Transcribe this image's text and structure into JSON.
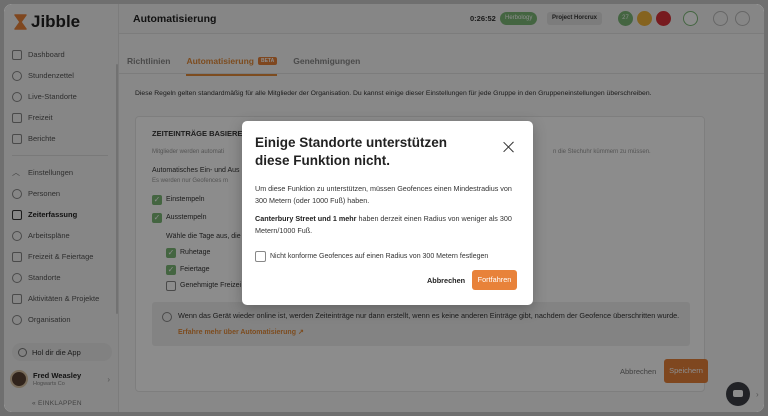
{
  "app": {
    "logo": "Jibble"
  },
  "sidebar": {
    "items": [
      {
        "label": "Dashboard"
      },
      {
        "label": "Stundenzettel"
      },
      {
        "label": "Live-Standorte"
      },
      {
        "label": "Freizeit"
      },
      {
        "label": "Berichte"
      },
      {
        "label": "Einstellungen"
      },
      {
        "label": "Personen"
      },
      {
        "label": "Zeiterfassung"
      },
      {
        "label": "Arbeitspläne"
      },
      {
        "label": "Freizeit & Feiertage"
      },
      {
        "label": "Standorte"
      },
      {
        "label": "Aktivitäten & Projekte"
      },
      {
        "label": "Organisation"
      }
    ],
    "app_button": "Hol dir die App",
    "user": {
      "name": "Fred Weasley",
      "org": "Hogwarts Co"
    },
    "collapse": "EINKLAPPEN"
  },
  "header": {
    "title": "Automatisierung",
    "timer": "0:26:52",
    "activity": "Herbology",
    "project": "Project Horcrux",
    "timer_button_label": "27"
  },
  "tabs": [
    {
      "label": "Richtlinien"
    },
    {
      "label": "Automatisierung",
      "badge": "BETA"
    },
    {
      "label": "Genehmigungen"
    }
  ],
  "info_text": "Diese Regeln gelten standardmäßig für alle Mitglieder der Organisation. Du kannst einige dieser Einstellungen für jede Gruppe in den Gruppeneinstellungen überschreiben.",
  "card": {
    "title": "ZEITEINTRÄGE BASIEREN",
    "desc": "Mitglieder werden automati",
    "desc_right": "n die Stechuhr kümmern zu müssen.",
    "auto_label": "Automatisches Ein- und Aus",
    "auto_sub": "Es werden nur Geofences m",
    "clock_in": "Einstempeln",
    "clock_out": "Ausstempeln",
    "days_label": "Wähle die Tage aus, die",
    "rest_days": "Ruhetage",
    "holidays": "Feiertage",
    "approved_time_off": "Genehmigte Freizei",
    "banner_text": "Wenn das Gerät wieder online ist, werden Zeiteinträge nur dann erstellt, wenn es keine anderen Einträge gibt, nachdem der Geofence überschritten wurde.",
    "banner_link": "Erfahre mehr über Automatisierung",
    "cancel": "Abbrechen",
    "save": "Speichern"
  },
  "modal": {
    "title": "Einige Standorte unterstützen diese Funktion nicht.",
    "paragraph1": "Um diese Funktion zu unterstützen, müssen Geofences einen Mindestradius von 300 Metern (oder 1000 Fuß) haben.",
    "paragraph2_bold": "Canterbury Street und 1 mehr",
    "paragraph2_rest": " haben derzeit einen Radius von weniger als 300 Metern/1000 Fuß.",
    "checkbox_label": "Nicht konforme Geofences auf einen Radius von 300 Metern festlegen",
    "cancel": "Abbrechen",
    "continue": "Fortfahren"
  },
  "colors": {
    "accent": "#e8823a",
    "green": "#7cb877"
  }
}
